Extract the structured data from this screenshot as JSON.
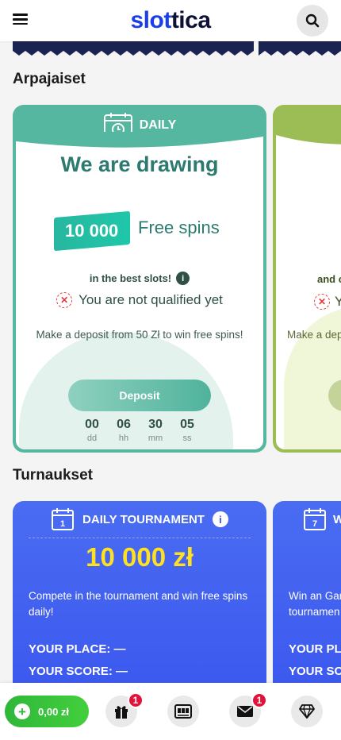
{
  "header": {
    "logo_part1": "slot",
    "logo_part2": "tica"
  },
  "lotteries": {
    "section_title": "Arpajaiset",
    "daily": {
      "label": "DAILY",
      "title": "We are drawing",
      "amount": "10 000",
      "prize_text": "Free spins",
      "subtitle": "in the best slots!",
      "status": "You are not qualified yet",
      "note": "Make a deposit from 50 Zł to win free spins!",
      "button": "Deposit",
      "timer": [
        {
          "value": "00",
          "label": "dd"
        },
        {
          "value": "06",
          "label": "hh"
        },
        {
          "value": "30",
          "label": "mm"
        },
        {
          "value": "05",
          "label": "ss"
        }
      ]
    },
    "next_card": {
      "subtitle_partial": "and c",
      "status_partial": "Y",
      "note_partial": "Make a dep"
    }
  },
  "tournaments": {
    "section_title": "Turnaukset",
    "daily": {
      "label": "DAILY TOURNAMENT",
      "prize": "10 000 zł",
      "description": "Compete in the tournament and win free spins daily!",
      "place": "YOUR PLACE: —",
      "score": "YOUR SCORE: —"
    },
    "next_card": {
      "label_partial": "W",
      "description_partial": "Win an Gar tournamen",
      "place_partial": "YOUR PLA",
      "score_partial": "YOUR SC"
    }
  },
  "bottom_nav": {
    "balance": "0,00 zł",
    "gift_badge": "1",
    "mail_badge": "1"
  },
  "colors": {
    "teal": "#56b7a0",
    "lime": "#9cbd55",
    "blue": "#3b57ee",
    "yellow": "#ffe11f",
    "green": "#2fb73a"
  }
}
